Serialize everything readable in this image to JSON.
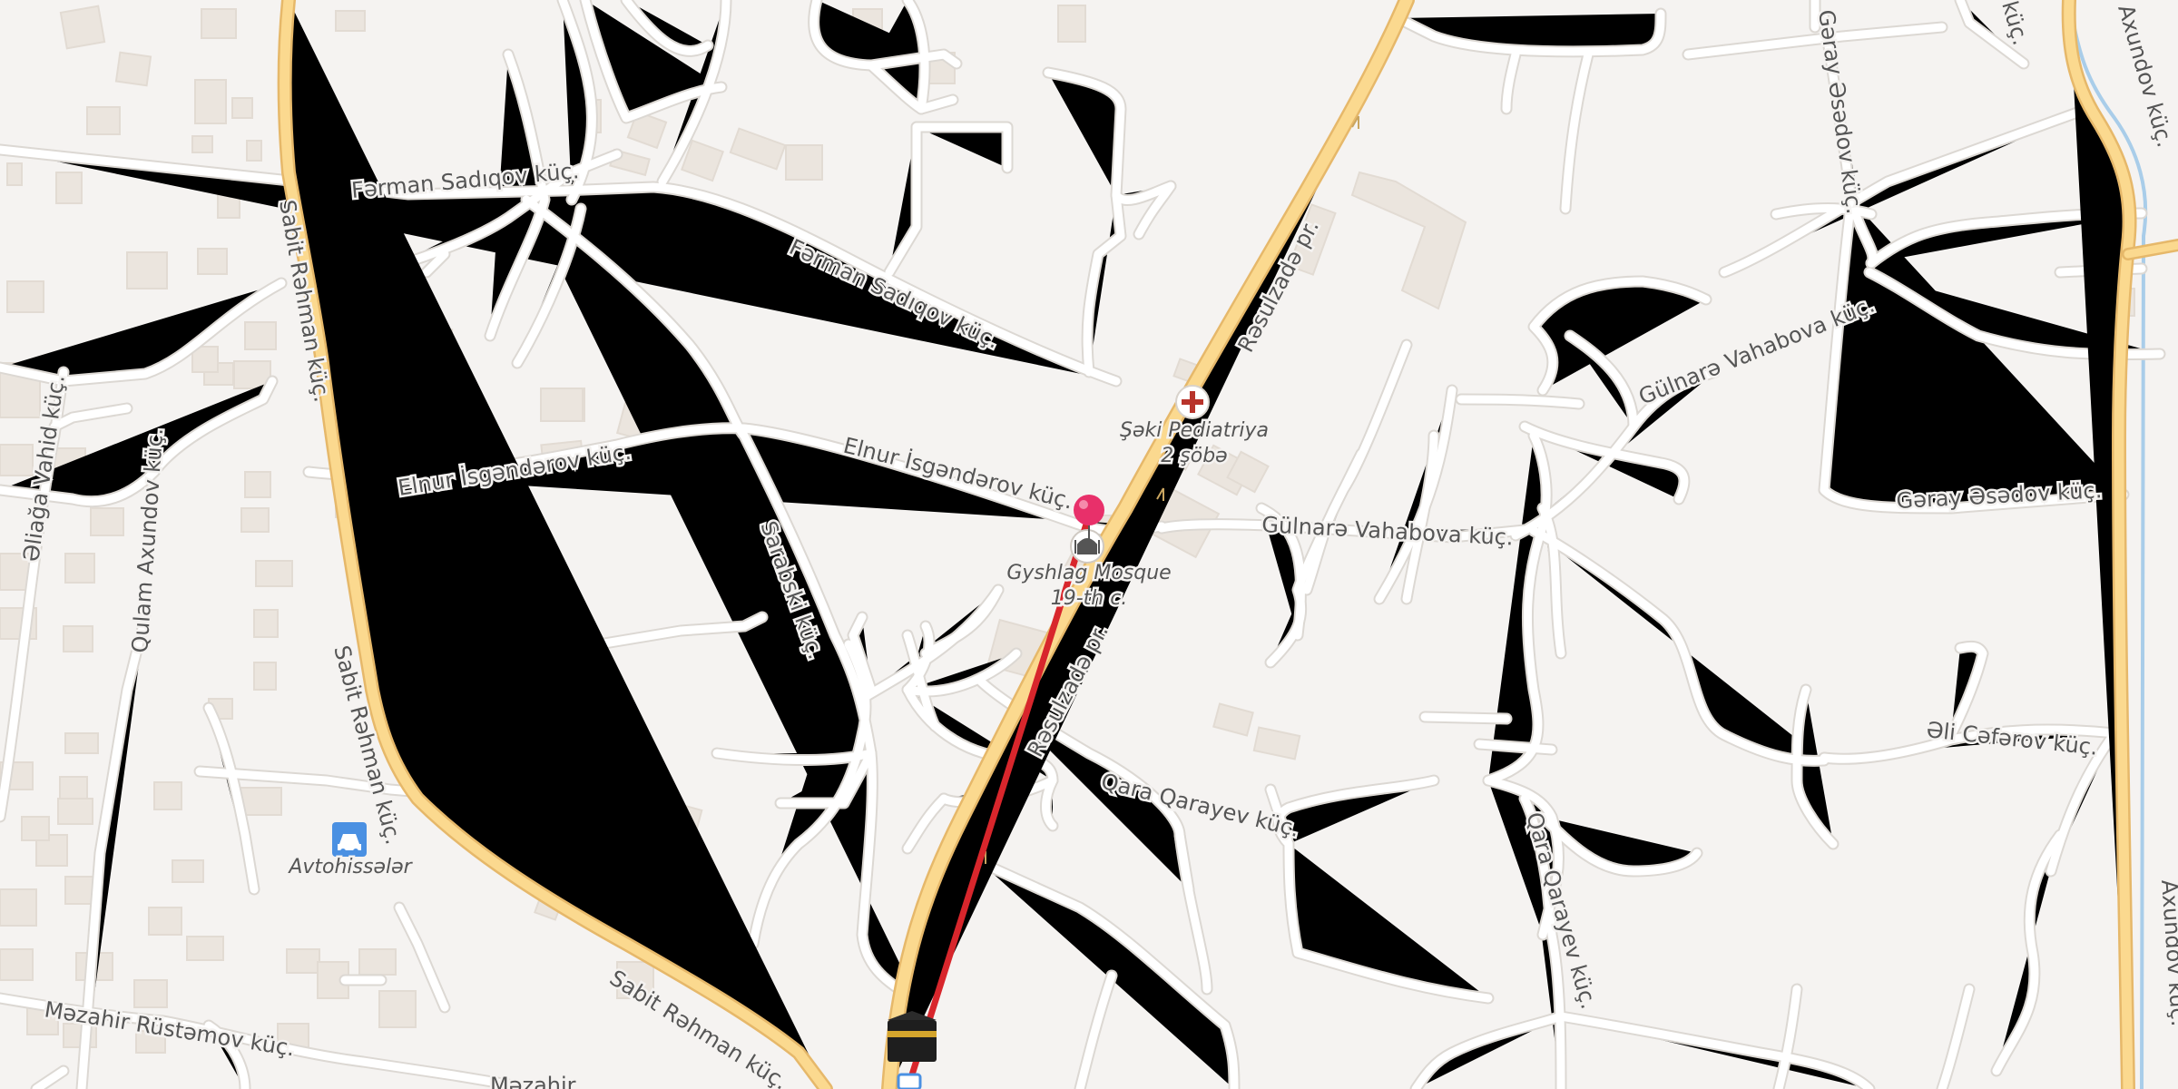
{
  "streets": {
    "ferman_1": "Fərman Sadıqov küç.",
    "ferman_2": "Fərman Sadıqov küç.",
    "sabit_1": "Sabit Rəhman küç.",
    "sabit_2": "Sabit Rəhman küç.",
    "sabit_3": "Sabit Rəhman küç.",
    "elnur_1": "Elnur İsgəndərov küç.",
    "elnur_2": "Elnur İsgəndərov küç.",
    "resulzade_1": "Rəsulzadə pr.",
    "resulzade_2": "Rəsulzadə pr.",
    "gulnare_1": "Gülnarə Vahabova küç.",
    "gulnare_2": "Gülnarə Vahabova küç.",
    "garay_1": "Gəray Əsədov küç.",
    "garay_2": "Gəray Əsədov küç.",
    "axundov_1": "Axundov küç.",
    "axundov_2": "Axundov küç.",
    "kuc_top": "küç.",
    "eliaga": "Əliağa Vahid küç.",
    "qulam": "Qulam Axundov küç.",
    "sarabski": "Sarabski küç.",
    "qara_1": "Qara Qarayev küç.",
    "qara_2": "Qara Qarayev küç.",
    "eli_cafarov": "Əli Cəfərov küç.",
    "mezahir": "Məzahir Rüstəmov küç.",
    "partial_bottom": "Məzahir"
  },
  "pois": {
    "pediatriya_line1": "Şəki Pediatriya",
    "pediatriya_line2": "2 şöbə",
    "mosque_line1": "Gyshlag Mosque",
    "mosque_line2": "19-th c.",
    "avtohissaler": "Avtohissələr"
  },
  "icons": {
    "hospital": "hospital-cross-icon",
    "mosque": "mosque-icon",
    "car_parts": "car-icon",
    "kaaba": "kaaba-icon",
    "bus": "bus-stop-icon",
    "pin": "location-pin-icon"
  },
  "colors": {
    "background": "#f5f3f1",
    "main_road": "#fbd98f",
    "route": "#d8262c",
    "pin": "#e8306a",
    "water": "#a9cde9"
  }
}
